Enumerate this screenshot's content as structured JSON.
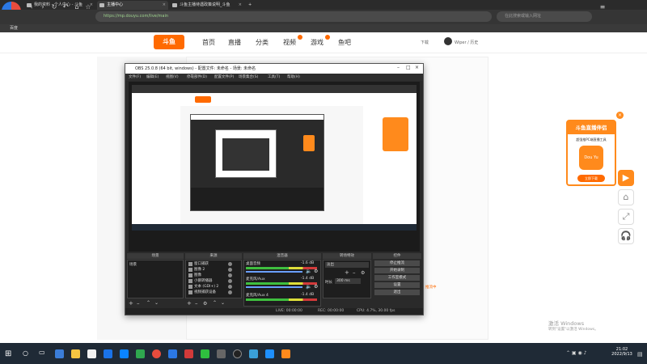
{
  "browser": {
    "logo_badge": "浏览器",
    "tabs": [
      {
        "label": "我的资料 - 个人中心 - 斗鱼"
      },
      {
        "label": "主播中心"
      },
      {
        "label": "斗鱼主播待遇政策说明_斗鱼"
      }
    ],
    "url": "https://mp.douyu.com/live/main",
    "search_placeholder": "在此搜索或输入网址",
    "bookmark": "百度"
  },
  "site": {
    "logo": "斗鱼",
    "logo_sub": "DOUYU.COM",
    "nav": [
      "首页",
      "直播",
      "分类",
      "视频",
      "游戏",
      "鱼吧"
    ],
    "download": "下载",
    "user": "Wiper / 历史"
  },
  "obs": {
    "title": "OBS 25.0.8 (64 bit, windows) - 配置文件: 未命名 - 场景: 未命名",
    "menu": [
      "文件(F)",
      "编辑(E)",
      "视图(V)",
      "停靠部件(D)",
      "配置文件(P)",
      "场景集合(S)",
      "工具(T)",
      "帮助(H)"
    ],
    "docks": {
      "scenes": "场景",
      "sources": "来源",
      "mixer": "混音器",
      "transitions": "转场特效",
      "controls": "控件"
    },
    "scene_item": "场景",
    "sources_list": [
      "窗口捕获",
      "图像 2",
      "图像",
      "小鹅转播器",
      "文本 (GDI+) 2",
      "视频捕获设备"
    ],
    "mixer_tracks": [
      {
        "name": "桌面音频",
        "db": "-1.6 dB"
      },
      {
        "name": "麦克风/Aux",
        "db": "-1.4 dB"
      },
      {
        "name": "麦克风/Aux 4",
        "db": "-1.4 dB"
      }
    ],
    "transition_select": "淡出",
    "duration_label": "时长",
    "duration_value": "300 ms",
    "controls": [
      "停止推流",
      "开始录制",
      "工作室模式",
      "设置",
      "退出"
    ],
    "streaming_tag": "推流中",
    "status": {
      "live": "LIVE: 00:00:00",
      "rec": "REC: 00:00:00",
      "cpu": "CPU: 4.7%, 30.00 fps"
    }
  },
  "ad": {
    "title": "斗鱼直播伴侣",
    "subtitle": "超强推PC端直播工具",
    "logo_text": "Dou Yu",
    "button": "立即下载"
  },
  "watermark": {
    "line1": "激活 Windows",
    "line2": "转到\"设置\"以激活 Windows。"
  },
  "taskbar": {
    "time": "21:02",
    "date": "2022/9/13"
  },
  "colors": {
    "accent": "#ff6a00",
    "ad_orange": "#ff8a1c",
    "taskbar": "#1f2a36"
  }
}
